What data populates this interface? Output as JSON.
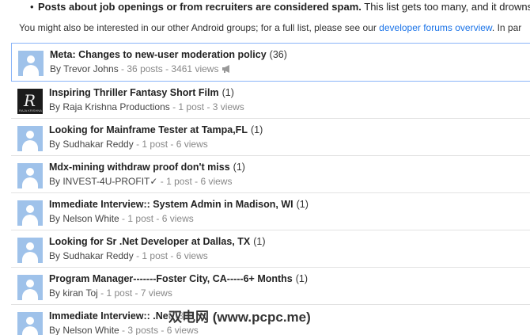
{
  "spam_rule": {
    "bold": "Posts about job openings or from recruiters are considered spam.",
    "rest": " This list gets too many, and it drowns out"
  },
  "intro": {
    "before": "You might also be interested in our other Android groups; for a full list, please see our ",
    "link": "developer forums overview",
    "after": ". In par"
  },
  "topics": [
    {
      "title": "Meta: Changes to new-user moderation policy",
      "count": "(36)",
      "author": "Trevor Johns",
      "stats": " - 36 posts - 3461 views"
    },
    {
      "title": "Inspiring Thriller Fantasy Short Film",
      "count": "(1)",
      "author": "Raja Krishna Productions",
      "stats": " - 1 post - 3 views"
    },
    {
      "title": "Looking for Mainframe Tester at Tampa,FL",
      "count": "(1)",
      "author": "Sudhakar Reddy",
      "stats": " - 1 post - 6 views"
    },
    {
      "title": "Mdx-mining withdraw proof don't miss",
      "count": "(1)",
      "author": "INVEST-4U-PROFIT✓",
      "stats": " - 1 post - 6 views"
    },
    {
      "title": "Immediate Interview:: System Admin in Madison, WI",
      "count": "(1)",
      "author": "Nelson White",
      "stats": " - 1 post - 6 views"
    },
    {
      "title": "Looking for Sr .Net Developer at Dallas, TX",
      "count": "(1)",
      "author": "Sudhakar Reddy",
      "stats": " - 1 post - 6 views"
    },
    {
      "title": "Program Manager-------Foster City, CA-----6+ Months",
      "count": "(1)",
      "author": "kiran Toj",
      "stats": " - 1 post - 7 views"
    },
    {
      "title": "Immediate Interview:: .Net",
      "count": "(3)",
      "author": "Nelson White",
      "stats": " - 3 posts - 6 views"
    }
  ],
  "by_label": "By ",
  "avatar_logo_letter": "R",
  "avatar_logo_text": "RAJA KRISHNA",
  "watermark": "双电网 (www.pcpc.me)",
  "colors": {
    "link": "#1a73e8",
    "avatar": "#9fc2ea",
    "selected_border": "#8ab4f8"
  }
}
